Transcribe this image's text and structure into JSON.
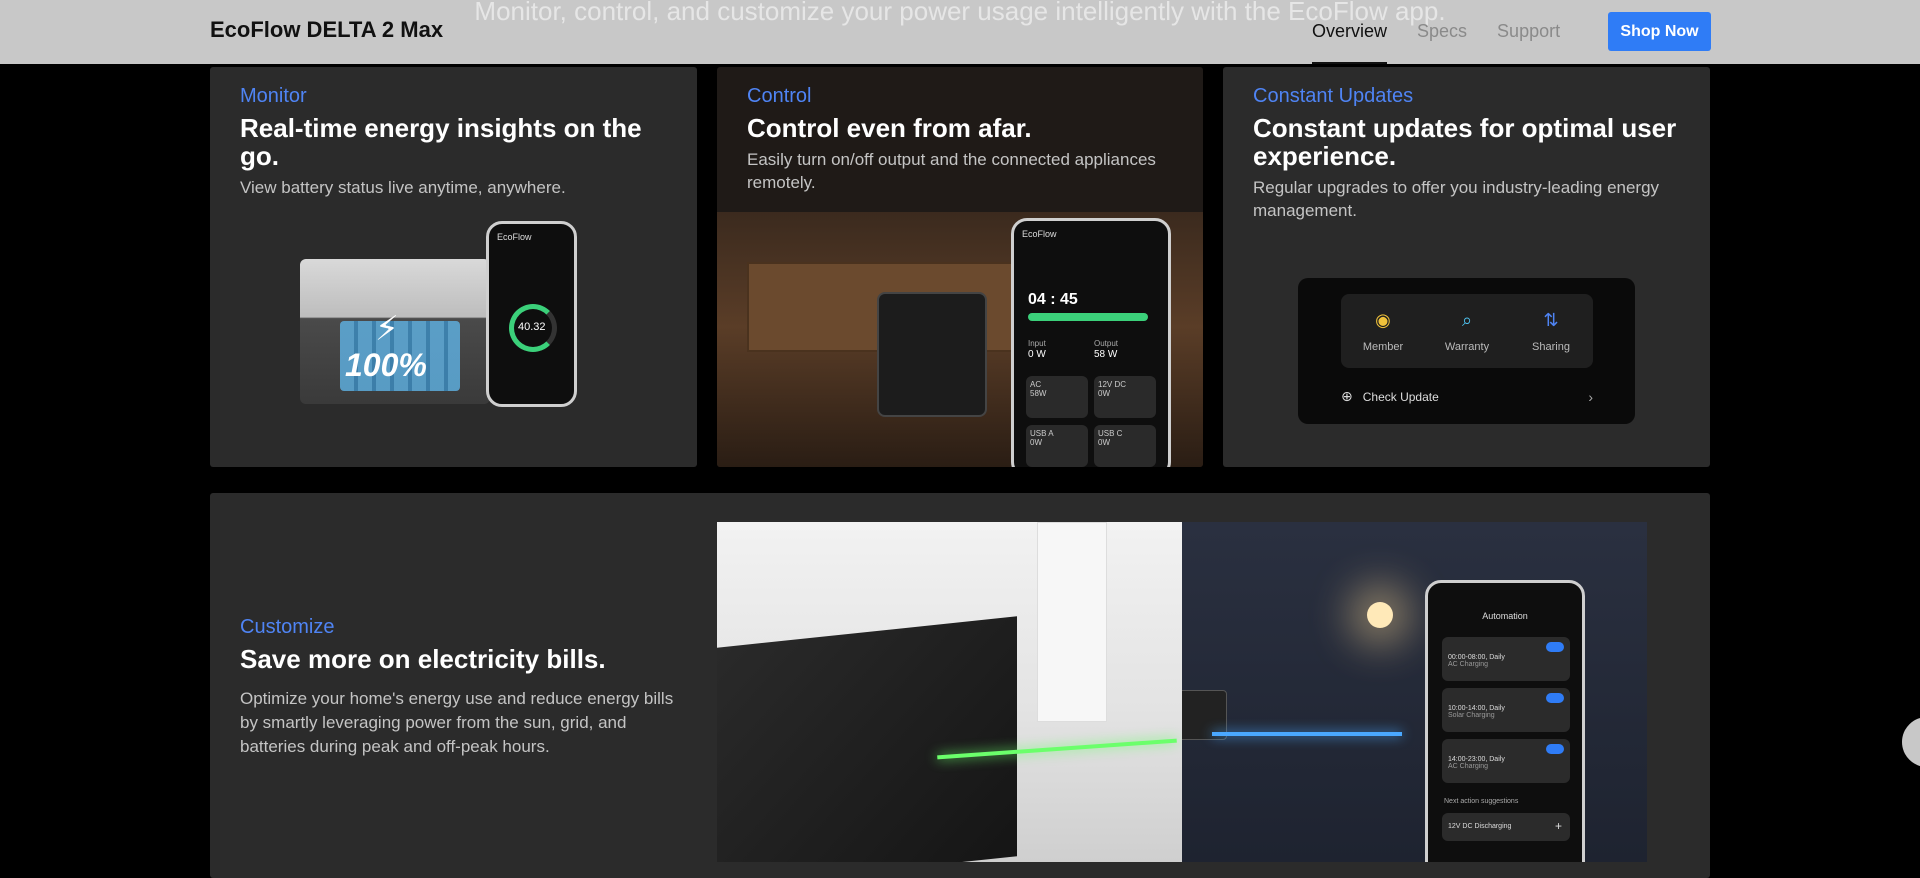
{
  "header": {
    "ghost_text": "Monitor, control, and customize your power usage intelligently with the EcoFlow app.",
    "brand": "EcoFlow DELTA 2 Max",
    "nav": [
      {
        "label": "Overview",
        "active": true
      },
      {
        "label": "Specs",
        "active": false
      },
      {
        "label": "Support",
        "active": false
      }
    ],
    "cta": "Shop Now"
  },
  "cards": {
    "monitor": {
      "kicker": "Monitor",
      "headline": "Real-time energy insights on the go.",
      "desc": "View battery status live anytime, anywhere.",
      "image": {
        "battery_label": "100%",
        "phone_title": "EcoFlow",
        "ring_value": "40.32"
      }
    },
    "control": {
      "kicker": "Control",
      "headline": "Control even from afar.",
      "desc": "Easily turn on/off output and the connected appliances remotely.",
      "image": {
        "phone_title": "EcoFlow",
        "time_value": "04 : 45",
        "input_label": "Input",
        "input_value": "0 W",
        "output_label": "Output",
        "output_value": "58 W",
        "tiles": [
          {
            "label": "AC",
            "value": "58W"
          },
          {
            "label": "12V DC",
            "value": "0W"
          },
          {
            "label": "USB A",
            "value": "0W"
          },
          {
            "label": "USB C",
            "value": "0W"
          }
        ]
      }
    },
    "updates": {
      "kicker": "Constant Updates",
      "headline": "Constant updates for optimal user experience.",
      "desc": "Regular upgrades to offer you industry-leading energy management.",
      "app_items": [
        {
          "label": "Member",
          "icon": "coins-icon"
        },
        {
          "label": "Warranty",
          "icon": "warranty-search-icon"
        },
        {
          "label": "Sharing",
          "icon": "sharing-icon"
        }
      ],
      "check_update": "Check Update"
    },
    "customize": {
      "kicker": "Customize",
      "headline": "Save more on electricity bills.",
      "desc": "Optimize your home's energy use and reduce energy bills by smartly leveraging power from the sun, grid, and batteries during peak and off-peak hours.",
      "phone": {
        "title": "Automation",
        "rules": [
          {
            "time": "00:00-08:00, Daily",
            "mode": "AC Charging"
          },
          {
            "time": "10:00-14:00, Daily",
            "mode": "Solar Charging"
          },
          {
            "time": "14:00-23:00, Daily",
            "mode": "AC Charging"
          }
        ],
        "suggestions_label": "Next action suggestions",
        "suggestion": "12V DC Discharging"
      }
    }
  },
  "colors": {
    "accent": "#4f84f4",
    "cta": "#2f7cf6",
    "card_bg": "#2b2b2b"
  }
}
